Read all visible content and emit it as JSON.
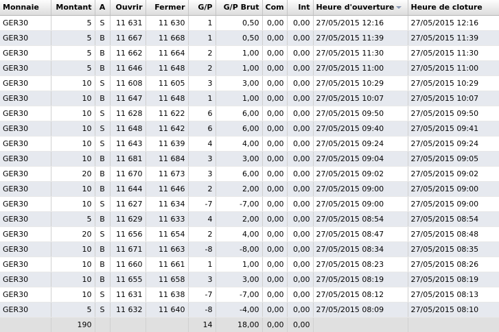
{
  "columns": {
    "monnaie": "Monnaie",
    "montant": "Montant",
    "a": "A",
    "ouvrir": "Ouvrir",
    "fermer": "Fermer",
    "gp": "G/P",
    "gp_brut": "G/P Brut",
    "com": "Com",
    "int": "Int",
    "heure_ouverture": "Heure d'ouverture",
    "heure_cloture": "Heure de cloture"
  },
  "sort_indicator_icon": "sort-descending-icon",
  "rows": [
    {
      "monnaie": "GER30",
      "montant": "5",
      "a": "S",
      "ouvrir": "11 631",
      "fermer": "11 630",
      "gp": "1",
      "gp_brut": "0,50",
      "com": "0,00",
      "int": "0,00",
      "ouverture": "27/05/2015 12:16",
      "cloture": "27/05/2015 12:16"
    },
    {
      "monnaie": "GER30",
      "montant": "5",
      "a": "B",
      "ouvrir": "11 667",
      "fermer": "11 668",
      "gp": "1",
      "gp_brut": "0,50",
      "com": "0,00",
      "int": "0,00",
      "ouverture": "27/05/2015 11:39",
      "cloture": "27/05/2015 11:39"
    },
    {
      "monnaie": "GER30",
      "montant": "5",
      "a": "B",
      "ouvrir": "11 662",
      "fermer": "11 664",
      "gp": "2",
      "gp_brut": "1,00",
      "com": "0,00",
      "int": "0,00",
      "ouverture": "27/05/2015 11:30",
      "cloture": "27/05/2015 11:30"
    },
    {
      "monnaie": "GER30",
      "montant": "5",
      "a": "B",
      "ouvrir": "11 646",
      "fermer": "11 648",
      "gp": "2",
      "gp_brut": "1,00",
      "com": "0,00",
      "int": "0,00",
      "ouverture": "27/05/2015 11:00",
      "cloture": "27/05/2015 11:00"
    },
    {
      "monnaie": "GER30",
      "montant": "10",
      "a": "S",
      "ouvrir": "11 608",
      "fermer": "11 605",
      "gp": "3",
      "gp_brut": "3,00",
      "com": "0,00",
      "int": "0,00",
      "ouverture": "27/05/2015 10:29",
      "cloture": "27/05/2015 10:29"
    },
    {
      "monnaie": "GER30",
      "montant": "10",
      "a": "B",
      "ouvrir": "11 647",
      "fermer": "11 648",
      "gp": "1",
      "gp_brut": "1,00",
      "com": "0,00",
      "int": "0,00",
      "ouverture": "27/05/2015 10:07",
      "cloture": "27/05/2015 10:07"
    },
    {
      "monnaie": "GER30",
      "montant": "10",
      "a": "S",
      "ouvrir": "11 628",
      "fermer": "11 622",
      "gp": "6",
      "gp_brut": "6,00",
      "com": "0,00",
      "int": "0,00",
      "ouverture": "27/05/2015 09:50",
      "cloture": "27/05/2015 09:50"
    },
    {
      "monnaie": "GER30",
      "montant": "10",
      "a": "S",
      "ouvrir": "11 648",
      "fermer": "11 642",
      "gp": "6",
      "gp_brut": "6,00",
      "com": "0,00",
      "int": "0,00",
      "ouverture": "27/05/2015 09:40",
      "cloture": "27/05/2015 09:41"
    },
    {
      "monnaie": "GER30",
      "montant": "10",
      "a": "S",
      "ouvrir": "11 643",
      "fermer": "11 639",
      "gp": "4",
      "gp_brut": "4,00",
      "com": "0,00",
      "int": "0,00",
      "ouverture": "27/05/2015 09:24",
      "cloture": "27/05/2015 09:24"
    },
    {
      "monnaie": "GER30",
      "montant": "10",
      "a": "B",
      "ouvrir": "11 681",
      "fermer": "11 684",
      "gp": "3",
      "gp_brut": "3,00",
      "com": "0,00",
      "int": "0,00",
      "ouverture": "27/05/2015 09:04",
      "cloture": "27/05/2015 09:05"
    },
    {
      "monnaie": "GER30",
      "montant": "20",
      "a": "B",
      "ouvrir": "11 670",
      "fermer": "11 673",
      "gp": "3",
      "gp_brut": "6,00",
      "com": "0,00",
      "int": "0,00",
      "ouverture": "27/05/2015 09:02",
      "cloture": "27/05/2015 09:02"
    },
    {
      "monnaie": "GER30",
      "montant": "10",
      "a": "B",
      "ouvrir": "11 644",
      "fermer": "11 646",
      "gp": "2",
      "gp_brut": "2,00",
      "com": "0,00",
      "int": "0,00",
      "ouverture": "27/05/2015 09:00",
      "cloture": "27/05/2015 09:00"
    },
    {
      "monnaie": "GER30",
      "montant": "10",
      "a": "S",
      "ouvrir": "11 627",
      "fermer": "11 634",
      "gp": "-7",
      "gp_brut": "-7,00",
      "com": "0,00",
      "int": "0,00",
      "ouverture": "27/05/2015 09:00",
      "cloture": "27/05/2015 09:00"
    },
    {
      "monnaie": "GER30",
      "montant": "5",
      "a": "B",
      "ouvrir": "11 629",
      "fermer": "11 633",
      "gp": "4",
      "gp_brut": "2,00",
      "com": "0,00",
      "int": "0,00",
      "ouverture": "27/05/2015 08:54",
      "cloture": "27/05/2015 08:54"
    },
    {
      "monnaie": "GER30",
      "montant": "20",
      "a": "S",
      "ouvrir": "11 656",
      "fermer": "11 654",
      "gp": "2",
      "gp_brut": "4,00",
      "com": "0,00",
      "int": "0,00",
      "ouverture": "27/05/2015 08:47",
      "cloture": "27/05/2015 08:48"
    },
    {
      "monnaie": "GER30",
      "montant": "10",
      "a": "B",
      "ouvrir": "11 671",
      "fermer": "11 663",
      "gp": "-8",
      "gp_brut": "-8,00",
      "com": "0,00",
      "int": "0,00",
      "ouverture": "27/05/2015 08:34",
      "cloture": "27/05/2015 08:35"
    },
    {
      "monnaie": "GER30",
      "montant": "10",
      "a": "B",
      "ouvrir": "11 660",
      "fermer": "11 661",
      "gp": "1",
      "gp_brut": "1,00",
      "com": "0,00",
      "int": "0,00",
      "ouverture": "27/05/2015 08:23",
      "cloture": "27/05/2015 08:26"
    },
    {
      "monnaie": "GER30",
      "montant": "10",
      "a": "B",
      "ouvrir": "11 655",
      "fermer": "11 658",
      "gp": "3",
      "gp_brut": "3,00",
      "com": "0,00",
      "int": "0,00",
      "ouverture": "27/05/2015 08:19",
      "cloture": "27/05/2015 08:19"
    },
    {
      "monnaie": "GER30",
      "montant": "10",
      "a": "S",
      "ouvrir": "11 631",
      "fermer": "11 638",
      "gp": "-7",
      "gp_brut": "-7,00",
      "com": "0,00",
      "int": "0,00",
      "ouverture": "27/05/2015 08:12",
      "cloture": "27/05/2015 08:13"
    },
    {
      "monnaie": "GER30",
      "montant": "5",
      "a": "S",
      "ouvrir": "11 632",
      "fermer": "11 640",
      "gp": "-8",
      "gp_brut": "-4,00",
      "com": "0,00",
      "int": "0,00",
      "ouverture": "27/05/2015 08:09",
      "cloture": "27/05/2015 08:10"
    }
  ],
  "totals": {
    "montant": "190",
    "gp": "14",
    "gp_brut": "18,00",
    "com": "0,00",
    "int": "0,00"
  }
}
